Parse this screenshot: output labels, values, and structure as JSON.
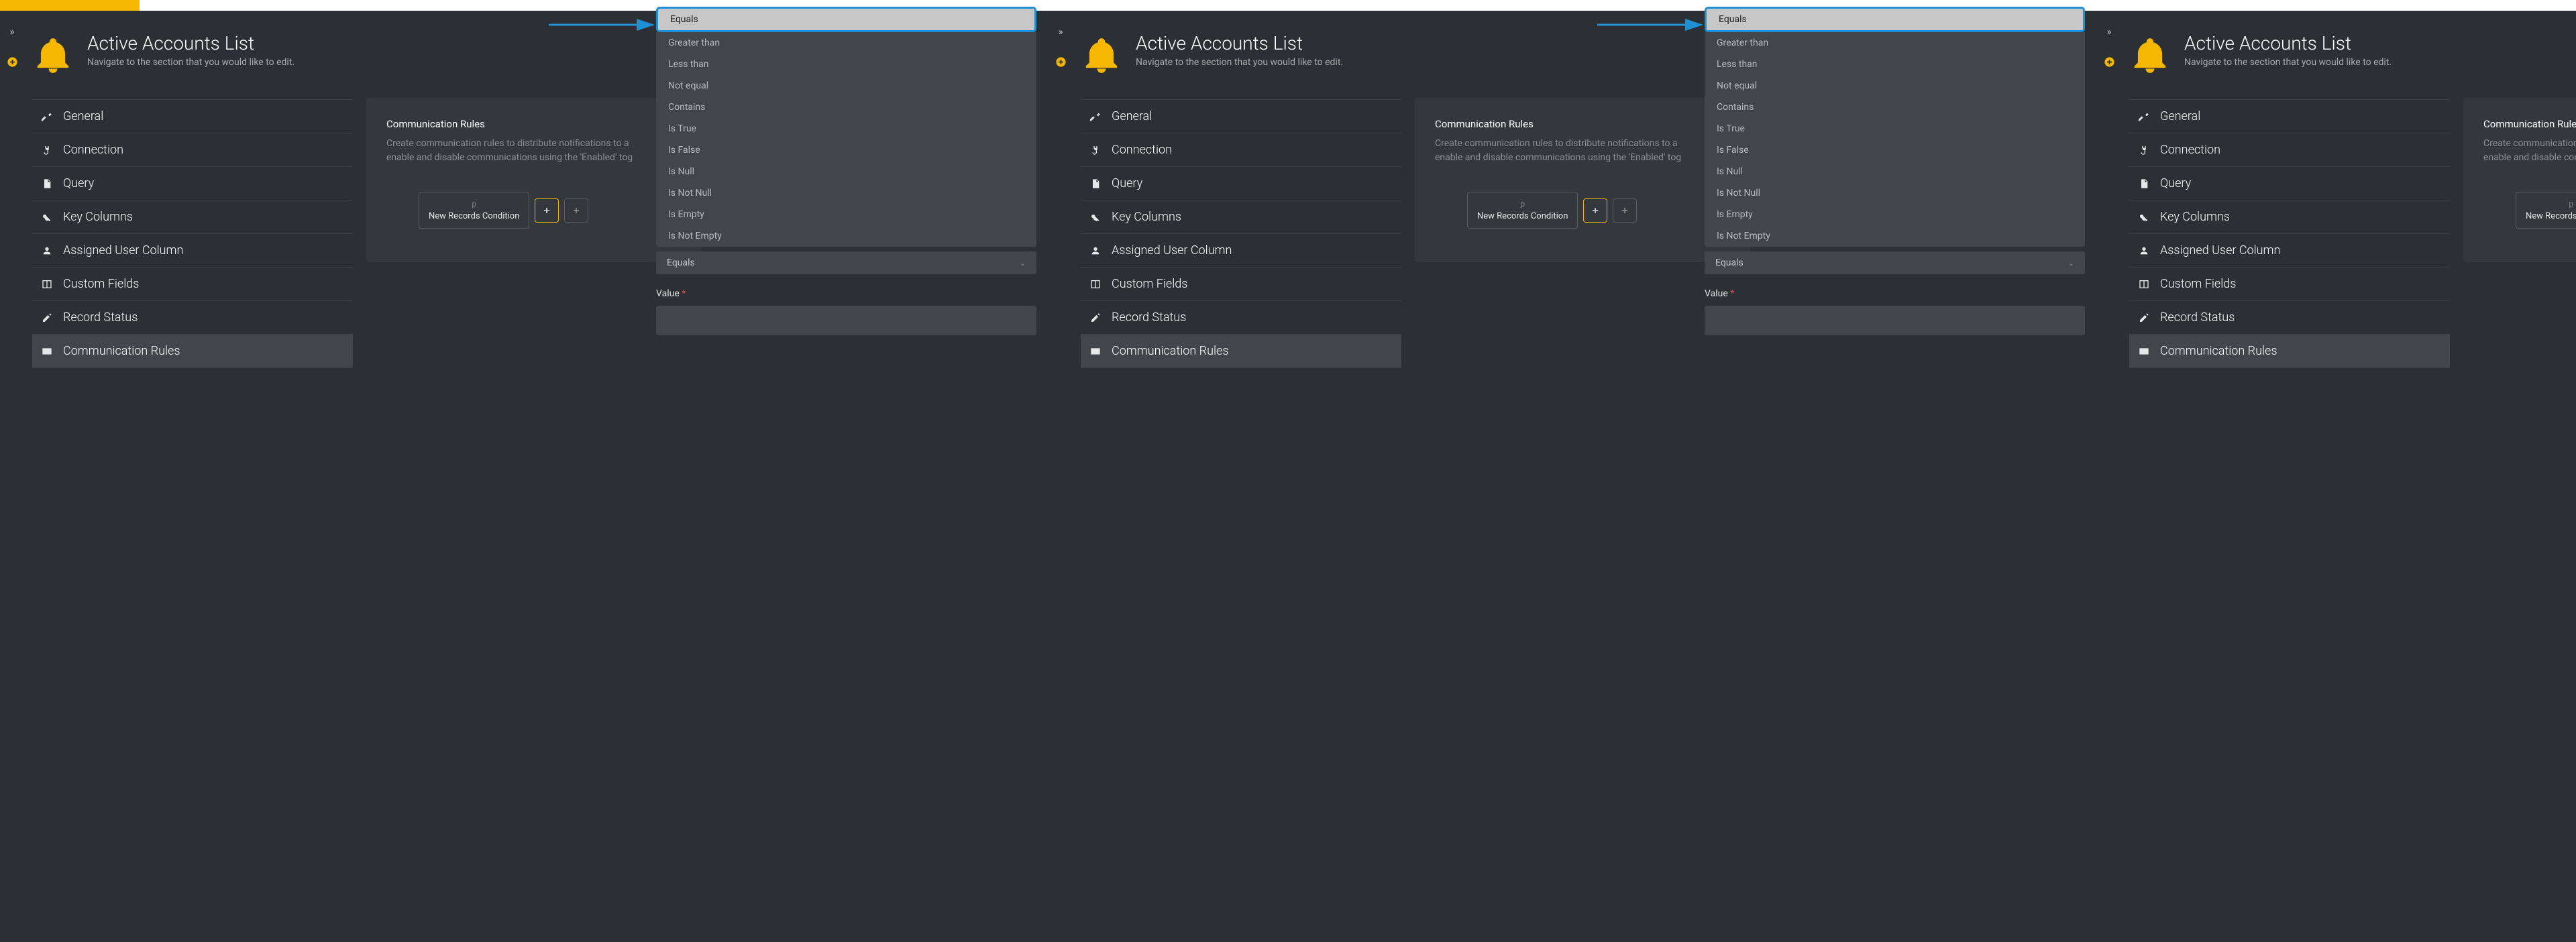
{
  "header": {
    "title": "Active Accounts List",
    "subtitle": "Navigate to the section that you would like to edit."
  },
  "nav": {
    "items": [
      {
        "icon": "wrench",
        "label": "General"
      },
      {
        "icon": "plug",
        "label": "Connection"
      },
      {
        "icon": "file",
        "label": "Query"
      },
      {
        "icon": "key",
        "label": "Key Columns"
      },
      {
        "icon": "user",
        "label": "Assigned User Column"
      },
      {
        "icon": "columns",
        "label": "Custom Fields"
      },
      {
        "icon": "edit",
        "label": "Record Status"
      },
      {
        "icon": "envelope",
        "label": "Communication Rules"
      }
    ],
    "active_index": 7
  },
  "mid_panel": {
    "title": "Communication Rules",
    "desc_line1": "Create communication rules to distribute notifications to a",
    "desc_line2": "enable and disable communications using the 'Enabled' tog",
    "chip_label": "New Records Condition",
    "chip_top": "p"
  },
  "dropdown": {
    "selected": "Equals",
    "options": [
      "Greater than",
      "Less than",
      "Not equal",
      "Contains",
      "Is True",
      "Is False",
      "Is Null",
      "Is Not Null",
      "Is Empty",
      "Is Not Empty"
    ]
  },
  "select_below": {
    "value": "Equals"
  },
  "value_field": {
    "label": "Value",
    "required": "*",
    "value": ""
  },
  "icons": {
    "expand": "»",
    "add": "+"
  }
}
